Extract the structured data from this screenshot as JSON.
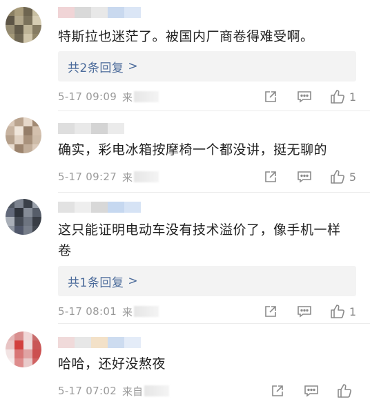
{
  "comments": [
    {
      "text": "特斯拉也迷茫了。被国内厂商卷得难受啊。",
      "reply_label": "共2条回复",
      "time": "5-17 09:09",
      "source_prefix": "来",
      "likes": "1",
      "avatar_colors": [
        "#8a7f63",
        "#a89b7a",
        "#6e6550",
        "#c8bfa2",
        "#5d5546",
        "#b1a68a",
        "#7b725b",
        "#d6cdb3",
        "#948a70",
        "#625a49",
        "#bdb396",
        "#857b62",
        "#a39878",
        "#6f6753",
        "#cfc5aa",
        "#918669"
      ],
      "name_colors": [
        "#f0d4d6",
        "#d9d9d9",
        "#e8e8e8",
        "#c9d9ef",
        "#dbe6f6"
      ]
    },
    {
      "text": "确实，彩电冰箱按摩椅一个都没讲，挺无聊的",
      "time": "5-17 09:27",
      "source_prefix": "来",
      "likes": "5",
      "avatar_colors": [
        "#d9c8b8",
        "#b9a38e",
        "#e6d8ca",
        "#a28a73",
        "#c7b3a0",
        "#efe5da",
        "#957e69",
        "#d3c0ad",
        "#b5a08b",
        "#e0d1c2",
        "#a9927c",
        "#cdbba8",
        "#e8dccf",
        "#9c846e",
        "#c1ad99",
        "#dccbbb"
      ],
      "name_colors": [
        "#dedede",
        "#e9e9e9",
        "#d4d4d4",
        "#ebebeb"
      ]
    },
    {
      "text": "这只能证明电动车没有技术溢价了，像手机一样卷",
      "reply_label": "共1条回复",
      "time": "5-17 08:01",
      "source_prefix": "来",
      "likes": "1",
      "avatar_colors": [
        "#4f5661",
        "#7c838f",
        "#3a4049",
        "#9aa1ab",
        "#62697a",
        "#2f343c",
        "#858c97",
        "#565d69",
        "#a9afb8",
        "#454b55",
        "#6d7480",
        "#383d45",
        "#8f96a1",
        "#50576a",
        "#777e8a",
        "#41474f"
      ],
      "name_colors": [
        "#e2e2e2",
        "#eeeeee",
        "#d8d8d8",
        "#c6d8f0",
        "#d6e3f5"
      ]
    },
    {
      "text": "哈哈，还好没熬夜",
      "time": "5-17 07:02",
      "source_prefix": "来自",
      "likes": "",
      "avatar_colors": [
        "#e4b6b6",
        "#d98f8f",
        "#f0d6d6",
        "#c86b6b",
        "#e8c4c4",
        "#d2403e",
        "#eddcdc",
        "#c95757",
        "#f2e4e4",
        "#d87676",
        "#e0a3a3",
        "#cc5050",
        "#f5ecec",
        "#de8c8c",
        "#e9cbcb",
        "#d06262"
      ],
      "name_colors": [
        "#f0dada",
        "#e7e7e7",
        "#f3e1c8",
        "#cddcf0",
        "#e4ecf8"
      ]
    }
  ],
  "icons": {
    "share": "share-icon",
    "reply": "comment-icon",
    "like": "thumbs-up-icon",
    "chevron": "chevron-right-icon"
  },
  "chevron_glyph": ">",
  "colors": {
    "link": "#4a6a9a",
    "meta": "#9a9a9a",
    "reply_bg": "#f3f3f3"
  }
}
